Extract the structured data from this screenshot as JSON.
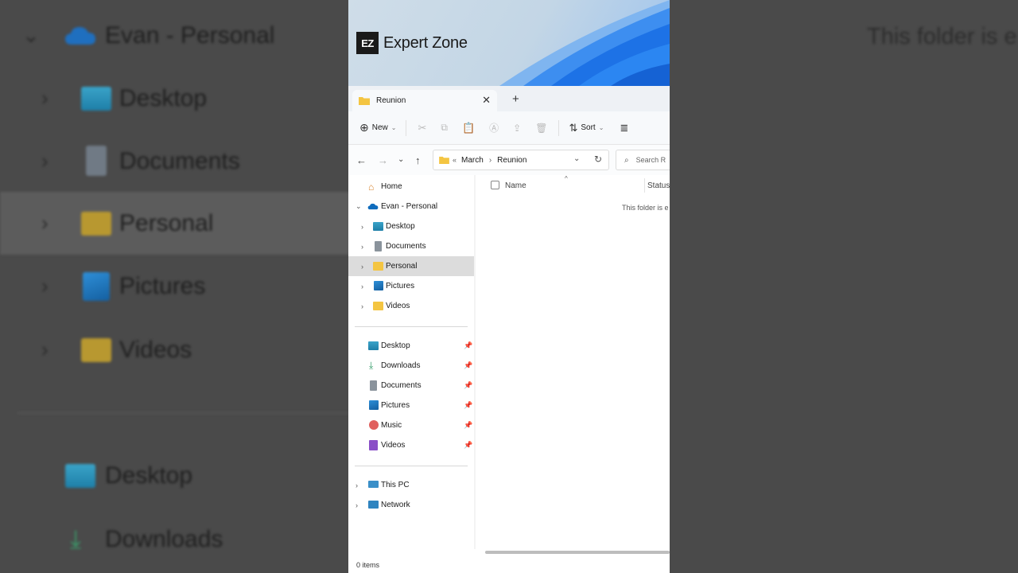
{
  "background": {
    "top_item": "Evan - Personal",
    "items": [
      "Desktop",
      "Documents",
      "Personal",
      "Pictures",
      "Videos"
    ],
    "quick_items": [
      "Desktop",
      "Downloads"
    ],
    "right_text": "This folder is e"
  },
  "watermark": {
    "mark": "EZ",
    "name": "Expert Zone"
  },
  "tab": {
    "label": "Reunion"
  },
  "toolbar": {
    "new_label": "New",
    "sort_label": "Sort"
  },
  "address": {
    "overflow": "«",
    "crumbs": [
      "March",
      "Reunion"
    ]
  },
  "search": {
    "placeholder": "Search R"
  },
  "nav": {
    "home": "Home",
    "onedrive": "Evan - Personal",
    "onedrive_children": [
      "Desktop",
      "Documents",
      "Personal",
      "Pictures",
      "Videos"
    ],
    "quick_access": [
      "Desktop",
      "Downloads",
      "Documents",
      "Pictures",
      "Music",
      "Videos"
    ],
    "this_pc": "This PC",
    "network": "Network"
  },
  "columns": {
    "name": "Name",
    "status": "Status"
  },
  "content": {
    "empty_message": "This folder is e"
  },
  "status": {
    "items": "0 items"
  },
  "colors": {
    "accent": "#0078d4",
    "folder": "#f4c542",
    "selection": "#dcdcdc"
  }
}
